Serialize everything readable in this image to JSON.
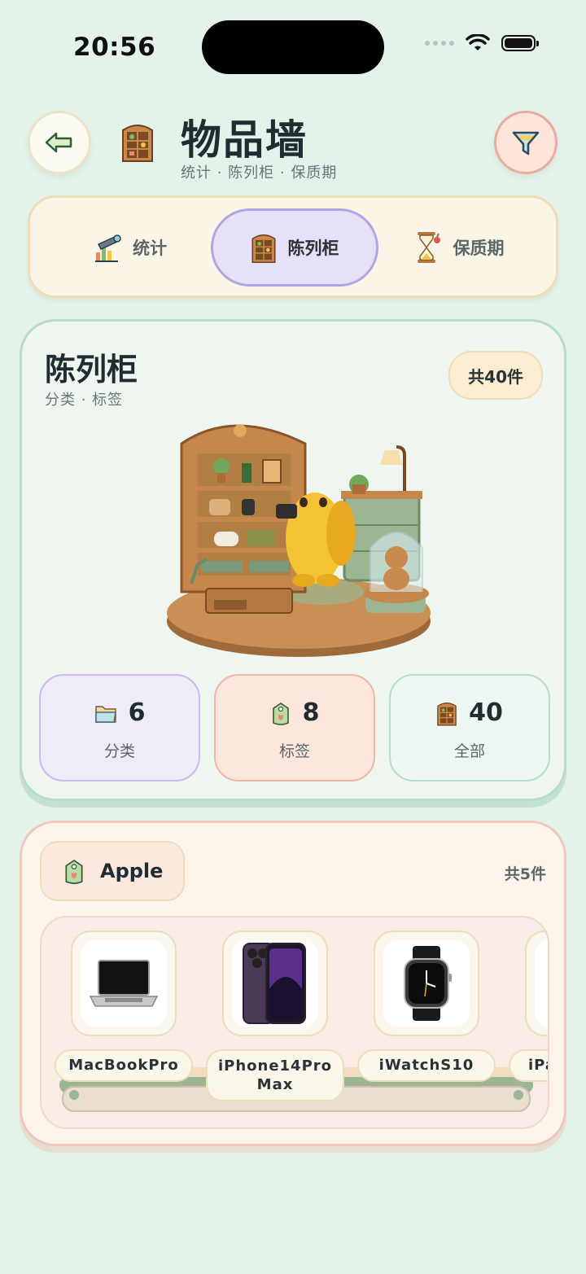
{
  "status_bar": {
    "time": "20:56"
  },
  "header": {
    "title": "物品墙",
    "subtitle": "统计 · 陈列柜 · 保质期",
    "back_icon": "arrow-left-icon",
    "filter_icon": "filter-funnel-icon"
  },
  "tabs": [
    {
      "label": "统计",
      "icon": "telescope-chart-icon",
      "active": false
    },
    {
      "label": "陈列柜",
      "icon": "cabinet-icon",
      "active": true
    },
    {
      "label": "保质期",
      "icon": "hourglass-icon",
      "active": false
    }
  ],
  "showcase": {
    "title": "陈列柜",
    "subtitle": "分类 · 标签",
    "count": "共40件",
    "stats": [
      {
        "value": "6",
        "label": "分类",
        "icon": "folder-icon"
      },
      {
        "value": "8",
        "label": "标签",
        "icon": "tag-icon"
      },
      {
        "value": "40",
        "label": "全部",
        "icon": "cabinet-icon"
      }
    ]
  },
  "group": {
    "tag": "Apple",
    "count": "共5件",
    "items": [
      {
        "name": "MacBookPro"
      },
      {
        "name": "iPhone14Pro Max"
      },
      {
        "name": "iWatchS10"
      },
      {
        "name": "iPa"
      }
    ]
  },
  "colors": {
    "background": "#e3f3ea",
    "active_tab": "#e6e1f8",
    "accent_purple": "#b1a4e6",
    "accent_coral": "#ecaa9c"
  }
}
